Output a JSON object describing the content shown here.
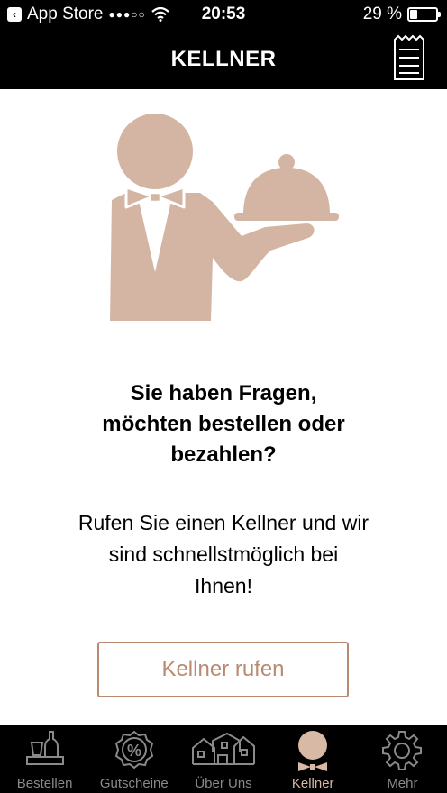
{
  "status_bar": {
    "back_app": "App Store",
    "signal": "●●●○○",
    "time": "20:53",
    "battery_text": "29 %",
    "battery_level": 0.29
  },
  "nav": {
    "title": "KELLNER",
    "receipt_icon": "receipt-icon"
  },
  "illustration": {
    "icon": "waiter-with-cloche-icon",
    "color": "#d4b5a4"
  },
  "content": {
    "question_lines": [
      "Sie haben Fragen,",
      "möchten bestellen oder",
      "bezahlen?"
    ],
    "info_lines": [
      "Rufen Sie einen Kellner und wir",
      "sind schnellstmöglich bei",
      "Ihnen!"
    ],
    "call_button": "Kellner rufen"
  },
  "colors": {
    "accent": "#b98a6f",
    "active_tab": "#d8b9a5",
    "inactive_tab": "#8a8a8a",
    "bars": "#000000"
  },
  "tabs": [
    {
      "label": "Bestellen",
      "icon": "bottle-glass-icon",
      "active": false
    },
    {
      "label": "Gutscheine",
      "icon": "percent-badge-icon",
      "active": false
    },
    {
      "label": "Über Uns",
      "icon": "buildings-icon",
      "active": false
    },
    {
      "label": "Kellner",
      "icon": "waiter-icon",
      "active": true
    },
    {
      "label": "Mehr",
      "icon": "gear-icon",
      "active": false
    }
  ]
}
